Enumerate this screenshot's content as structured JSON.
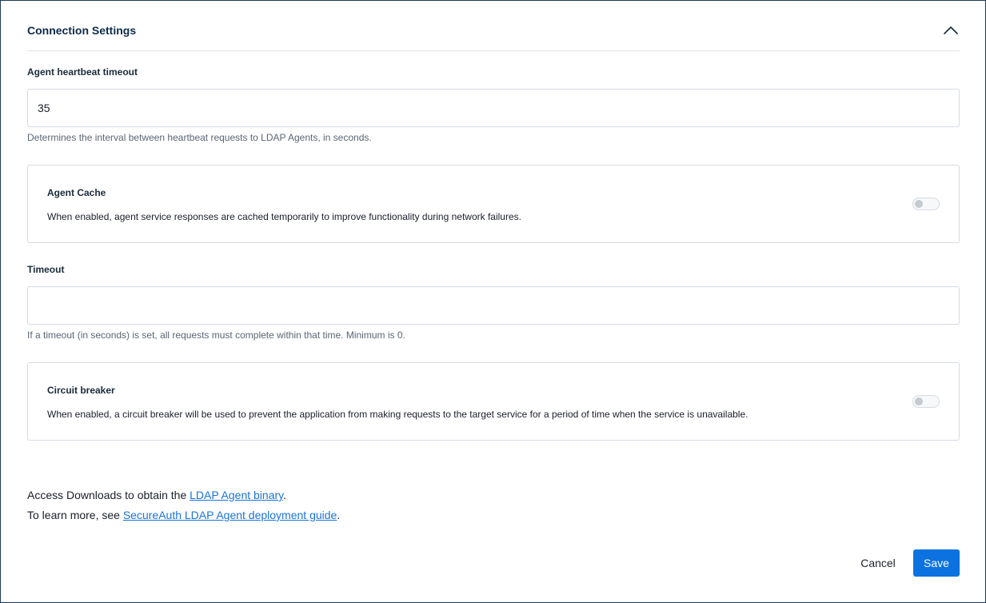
{
  "section": {
    "title": "Connection Settings",
    "collapse_icon": "chevron-up-icon"
  },
  "heartbeat": {
    "label": "Agent heartbeat timeout",
    "value": "35",
    "helper": "Determines the interval between heartbeat requests to LDAP Agents, in seconds."
  },
  "agent_cache": {
    "title": "Agent Cache",
    "description": "When enabled, agent service responses are cached temporarily to improve functionality during network failures.",
    "enabled": false
  },
  "timeout": {
    "label": "Timeout",
    "value": "",
    "helper": "If a timeout (in seconds) is set, all requests must complete within that time. Minimum is 0."
  },
  "circuit_breaker": {
    "title": "Circuit breaker",
    "description": "When enabled, a circuit breaker will be used to prevent the application from making requests to the target service for a period of time when the service is unavailable.",
    "enabled": false
  },
  "downloads": {
    "prefix": "Access Downloads to obtain the ",
    "link": "LDAP Agent binary",
    "suffix": "."
  },
  "learn_more": {
    "prefix": "To learn more, see ",
    "link": "SecureAuth LDAP Agent deployment guide",
    "suffix": "."
  },
  "actions": {
    "cancel_label": "Cancel",
    "save_label": "Save"
  },
  "colors": {
    "primary": "#0b72e0",
    "link": "#1a73d9",
    "title": "#0d2b4a"
  }
}
